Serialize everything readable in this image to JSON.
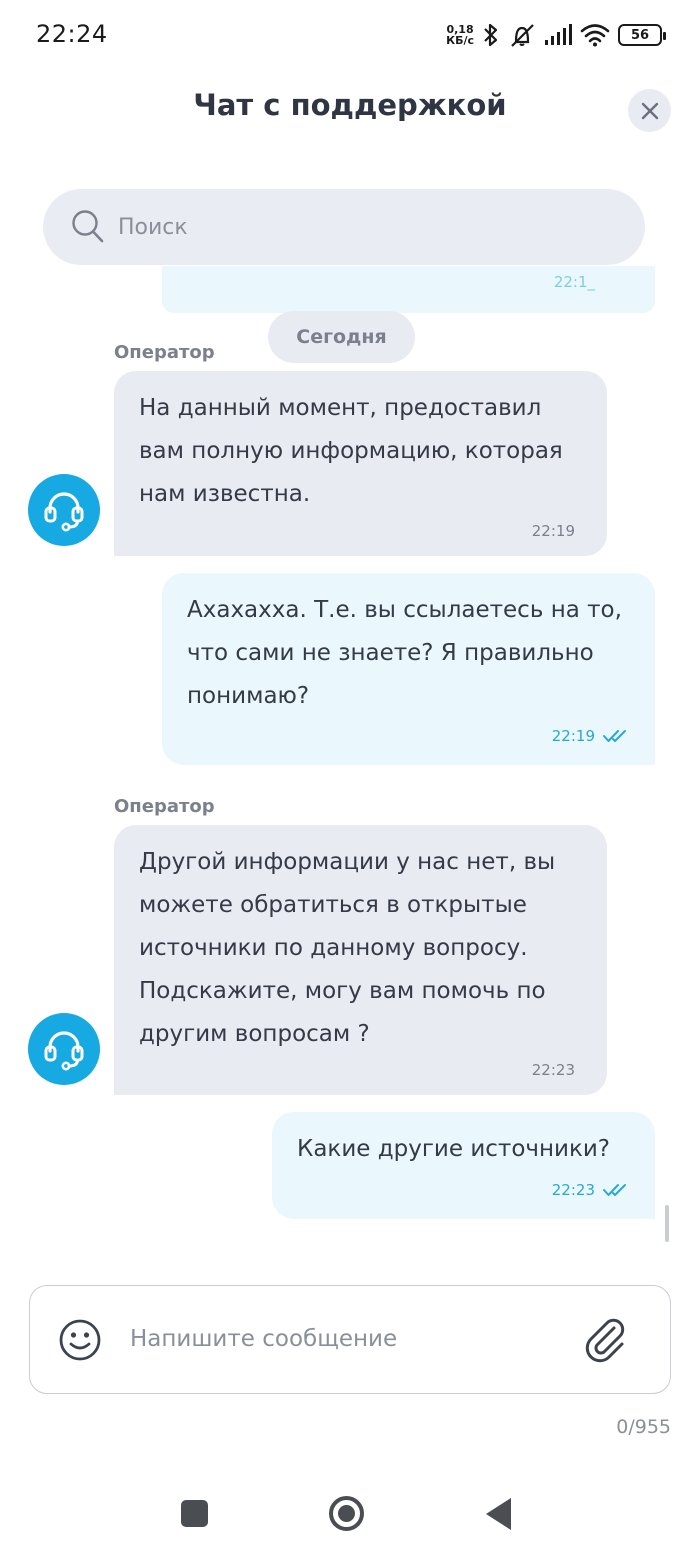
{
  "status_bar": {
    "time": "22:24",
    "net_speed_value": "0,18",
    "net_speed_unit": "КБ/с",
    "battery": "56"
  },
  "header": {
    "title": "Чат с поддержкой",
    "close_icon": "close-icon"
  },
  "search": {
    "placeholder": "Поиск",
    "icon": "search-icon"
  },
  "chat": {
    "partial_time": "22:1_",
    "date_separator": "Сегодня",
    "messages": [
      {
        "direction": "incoming",
        "sender": "Оператор",
        "text": "На данный момент, предоставил вам полную информацию, которая нам известна.",
        "time": "22:19"
      },
      {
        "direction": "outgoing",
        "text": "Ахахахха. Т.е. вы ссылаетесь на то, что сами не знаете? Я правильно понимаю?",
        "time": "22:19",
        "status": "read"
      },
      {
        "direction": "incoming",
        "sender": "Оператор",
        "text": "Другой информации у нас нет, вы можете обратиться в открытые источники по данному вопросу. Подскажите, могу вам помочь по другим вопросам ?",
        "time": "22:23"
      },
      {
        "direction": "outgoing",
        "text": "Какие другие источники?",
        "time": "22:23",
        "status": "read"
      }
    ]
  },
  "composer": {
    "placeholder": "Напишите сообщение",
    "counter": "0/955",
    "emoji_icon": "smiley-icon",
    "attach_icon": "paperclip-icon"
  },
  "colors": {
    "accent": "#17a9e1",
    "incoming_bubble": "#e9ebf2",
    "outgoing_bubble": "#eaf7fd",
    "read_check": "#27a9d4"
  }
}
